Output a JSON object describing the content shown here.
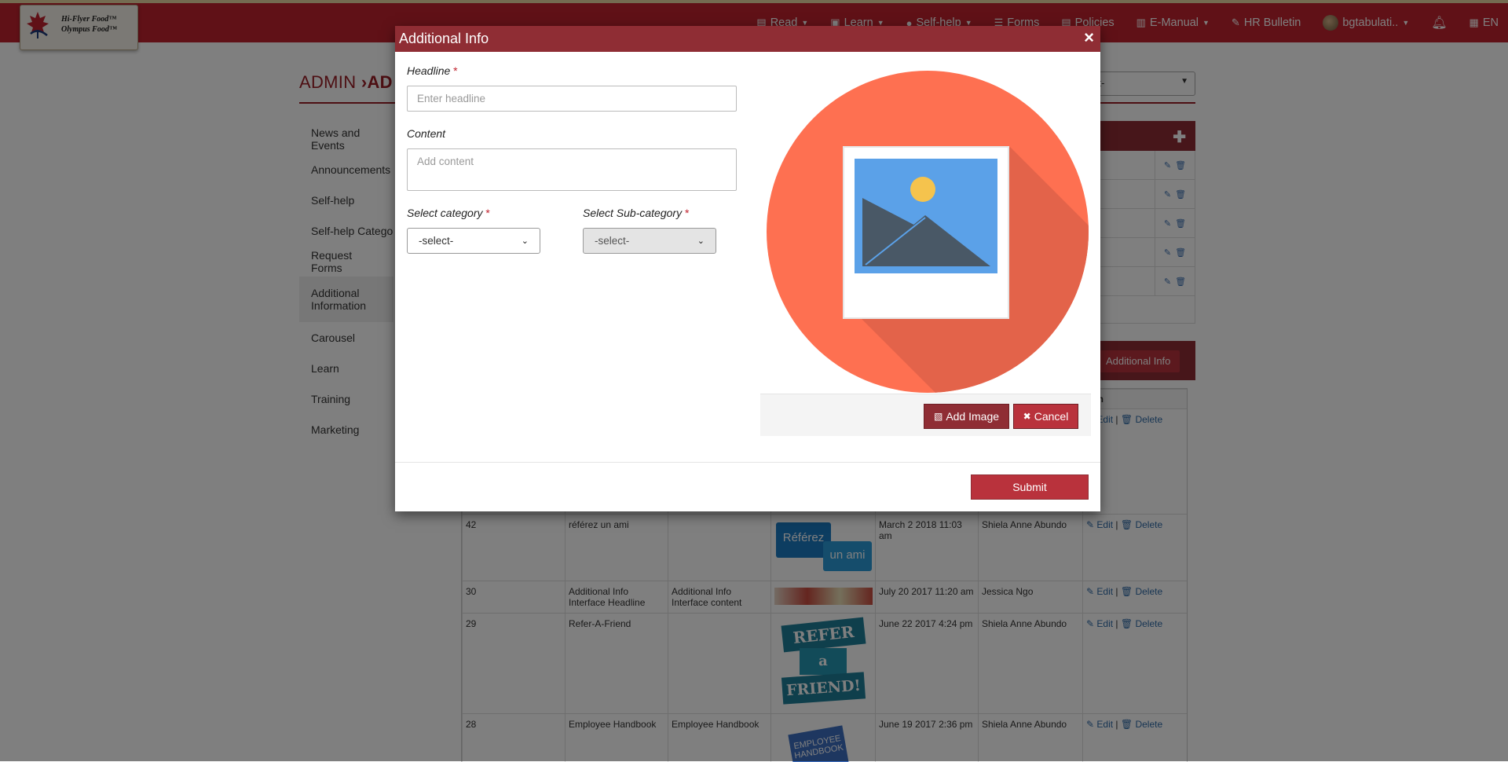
{
  "brand": {
    "line1": "Hi-Flyer Food™",
    "line2": "Olympus Food™"
  },
  "nav": {
    "items": [
      {
        "icon": "book-icon",
        "label": "Read",
        "caret": true
      },
      {
        "icon": "graduation-icon",
        "label": "Learn",
        "caret": true
      },
      {
        "icon": "globe-icon",
        "label": "Self-help",
        "caret": true
      },
      {
        "icon": "list-icon",
        "label": "Forms",
        "caret": false
      },
      {
        "icon": "file-icon",
        "label": "Policies",
        "caret": false
      },
      {
        "icon": "book-icon",
        "label": "E-Manual",
        "caret": true
      },
      {
        "icon": "pin-icon",
        "label": "HR Bulletin",
        "caret": false
      }
    ],
    "user": "bgtabulati..",
    "language": "EN"
  },
  "page": {
    "breadcrumb_root": "ADMIN",
    "breadcrumb_sep": "›",
    "breadcrumb_current": "AD",
    "select_value": "ct-",
    "add_info_button": "Additional Info"
  },
  "sidebar": {
    "items": [
      "News and Events",
      "Announcements",
      "Self-help",
      "Self-help Categories",
      "Request Forms",
      "Additional Information",
      "Carousel",
      "Learn",
      "Training",
      "Marketing"
    ],
    "active_index": 5
  },
  "table": {
    "header_last": "tion",
    "rows": [
      {
        "id": "42",
        "headline": "référez un ami",
        "content": "",
        "image": "referez",
        "date": "March 2 2018 11:03 am",
        "author": "Shiela Anne Abundo"
      },
      {
        "id": "30",
        "headline": "Additional Info Interface Headline",
        "content": "Additional Info Interface content",
        "image": "strip",
        "date": "July 20 2017 11:20 am",
        "author": "Jessica Ngo"
      },
      {
        "id": "29",
        "headline": "Refer-A-Friend",
        "content": "",
        "image": "refer",
        "date": "June 22 2017 4:24 pm",
        "author": "Shiela Anne Abundo"
      },
      {
        "id": "28",
        "headline": "Employee Handbook",
        "content": "Employee Handbook",
        "image": "employee",
        "date": "June 19 2017 2:36 pm",
        "author": "Shiela Anne Abundo"
      }
    ],
    "edit_label": "Edit",
    "delete_label": "Delete",
    "referez_text1": "Référez",
    "referez_text2": "un ami",
    "refer_text1": "REFER",
    "refer_text2": "a",
    "refer_text3": "FRIEND!",
    "employee_text": "EMPLOYEE HANDBOOK"
  },
  "modal": {
    "title": "Additional Info",
    "close": "×",
    "headline_label": "Headline",
    "headline_placeholder": "Enter headline",
    "headline_value": "",
    "content_label": "Content",
    "content_placeholder": "Add content",
    "content_value": "",
    "category_label": "Select category",
    "category_value": "-select-",
    "subcategory_label": "Select Sub-category",
    "subcategory_value": "-select-",
    "required_mark": "*",
    "add_image_button": "Add Image",
    "cancel_button": "Cancel",
    "submit_button": "Submit"
  },
  "colors": {
    "brand_red": "#c0222e",
    "dark_red": "#8f2d34",
    "button_red": "#b9323c",
    "image_circle": "#fe7051",
    "image_sky": "#5ba1e8"
  }
}
